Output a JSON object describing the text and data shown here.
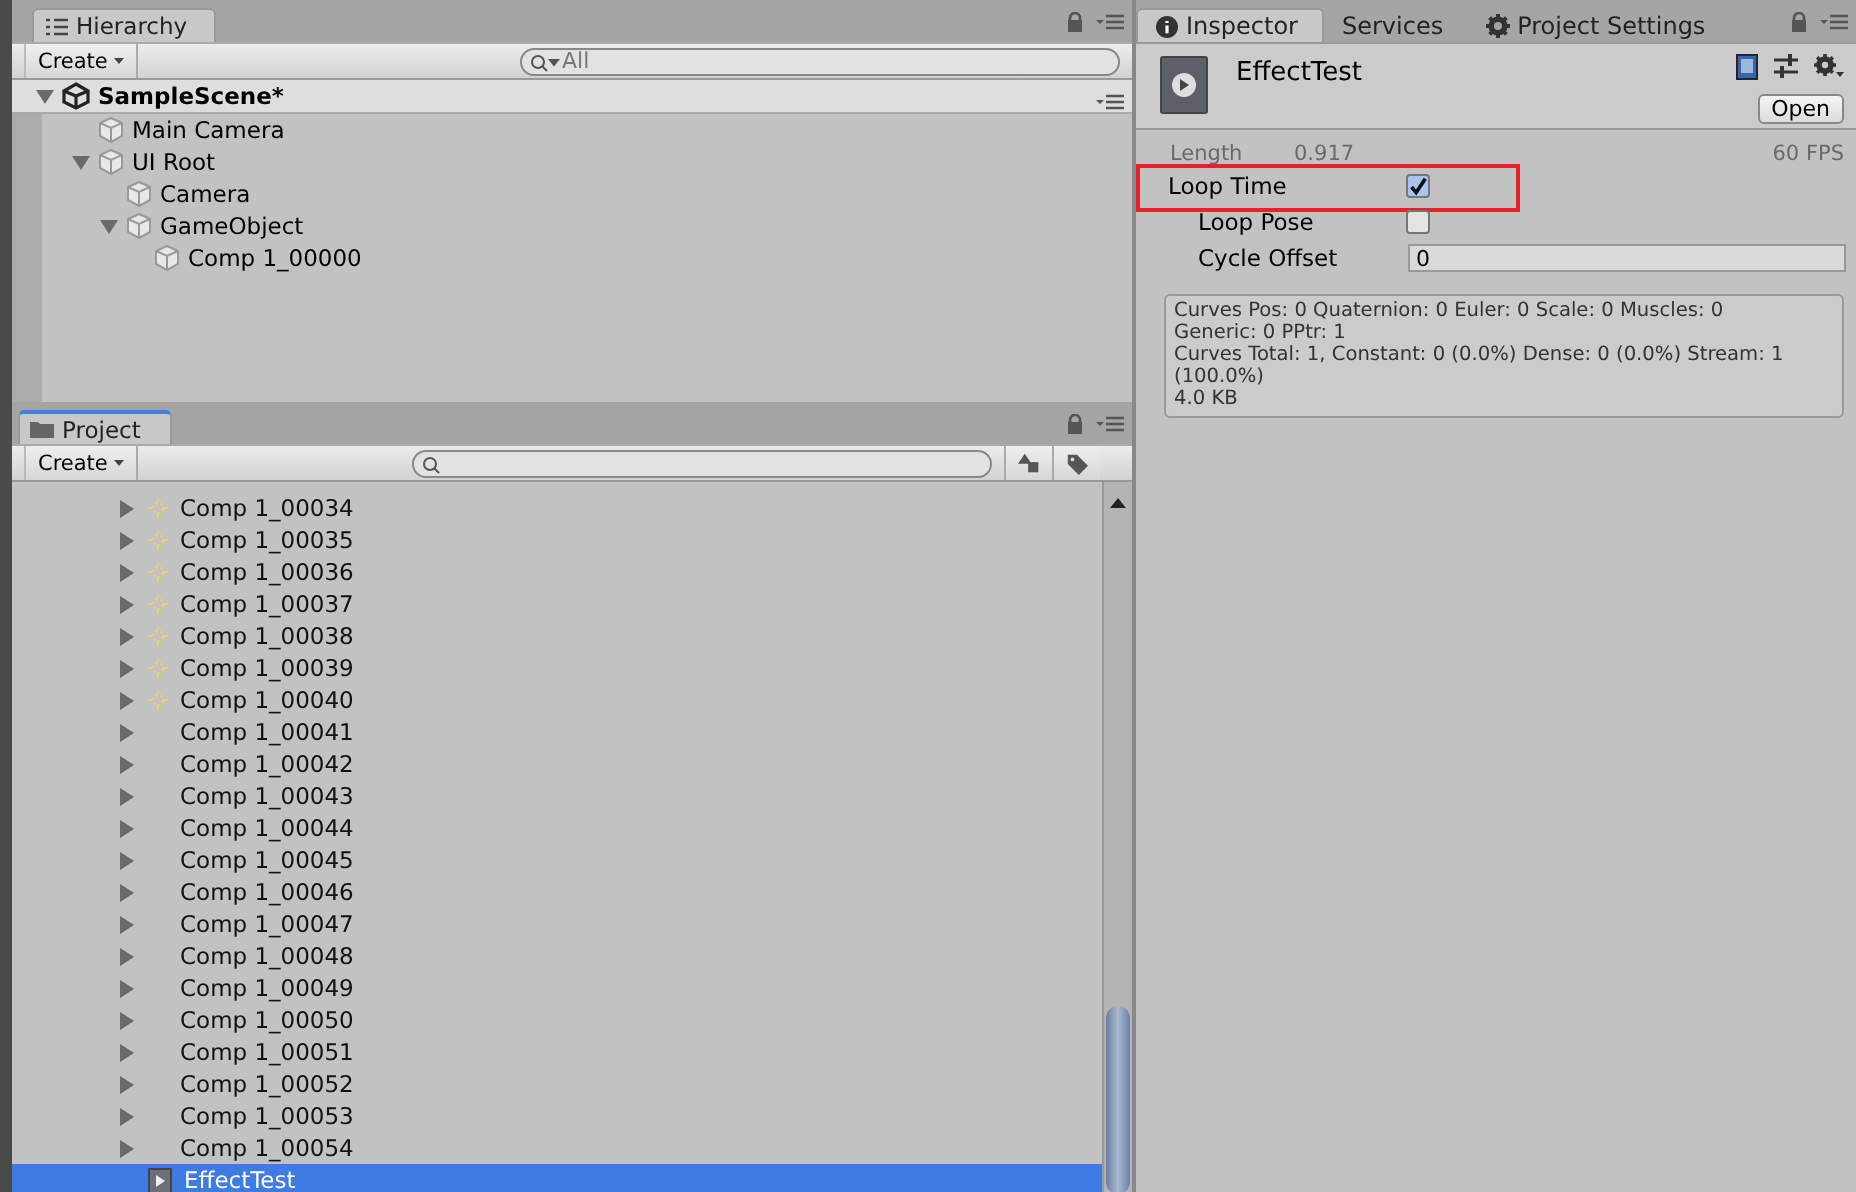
{
  "hierarchy": {
    "tab": "Hierarchy",
    "create": "Create",
    "search": {
      "placeholder": "All"
    },
    "scene": {
      "name": "SampleScene*",
      "expanded": true,
      "children": [
        {
          "label": "Main Camera"
        },
        {
          "label": "UI Root",
          "expanded": true,
          "children": [
            {
              "label": "Camera"
            },
            {
              "label": "GameObject",
              "expanded": true,
              "children": [
                {
                  "label": "Comp 1_00000"
                }
              ]
            }
          ]
        }
      ]
    }
  },
  "project": {
    "tab": "Project",
    "create": "Create",
    "items": [
      {
        "label": "Comp 1_00034",
        "kind": "effect",
        "expanded": false,
        "selected": false
      },
      {
        "label": "Comp 1_00035",
        "kind": "effect",
        "expanded": false,
        "selected": false
      },
      {
        "label": "Comp 1_00036",
        "kind": "effect",
        "expanded": false,
        "selected": false
      },
      {
        "label": "Comp 1_00037",
        "kind": "effect",
        "expanded": false,
        "selected": false
      },
      {
        "label": "Comp 1_00038",
        "kind": "effect",
        "expanded": false,
        "selected": false
      },
      {
        "label": "Comp 1_00039",
        "kind": "effect",
        "expanded": false,
        "selected": false
      },
      {
        "label": "Comp 1_00040",
        "kind": "effect",
        "expanded": false,
        "selected": false
      },
      {
        "label": "Comp 1_00041",
        "kind": "plain",
        "expanded": false,
        "selected": false
      },
      {
        "label": "Comp 1_00042",
        "kind": "plain",
        "expanded": false,
        "selected": false
      },
      {
        "label": "Comp 1_00043",
        "kind": "plain",
        "expanded": false,
        "selected": false
      },
      {
        "label": "Comp 1_00044",
        "kind": "plain",
        "expanded": false,
        "selected": false
      },
      {
        "label": "Comp 1_00045",
        "kind": "plain",
        "expanded": false,
        "selected": false
      },
      {
        "label": "Comp 1_00046",
        "kind": "plain",
        "expanded": false,
        "selected": false
      },
      {
        "label": "Comp 1_00047",
        "kind": "plain",
        "expanded": false,
        "selected": false
      },
      {
        "label": "Comp 1_00048",
        "kind": "plain",
        "expanded": false,
        "selected": false
      },
      {
        "label": "Comp 1_00049",
        "kind": "plain",
        "expanded": false,
        "selected": false
      },
      {
        "label": "Comp 1_00050",
        "kind": "plain",
        "expanded": false,
        "selected": false
      },
      {
        "label": "Comp 1_00051",
        "kind": "plain",
        "expanded": false,
        "selected": false
      },
      {
        "label": "Comp 1_00052",
        "kind": "plain",
        "expanded": false,
        "selected": false
      },
      {
        "label": "Comp 1_00053",
        "kind": "plain",
        "expanded": false,
        "selected": false
      },
      {
        "label": "Comp 1_00054",
        "kind": "plain",
        "expanded": false,
        "selected": false
      },
      {
        "label": "EffectTest",
        "kind": "clip",
        "selected": true
      }
    ]
  },
  "inspector": {
    "tabs": [
      {
        "label": "Inspector",
        "kind": "info",
        "selected": true
      },
      {
        "label": "Services",
        "selected": false
      },
      {
        "label": "Project Settings",
        "kind": "gear",
        "selected": false
      }
    ],
    "asset": {
      "title": "EffectTest",
      "open_button": "Open"
    },
    "length": {
      "label": "Length",
      "value": "0.917"
    },
    "fps": "60 FPS",
    "fields": [
      {
        "kind": "checkbox",
        "label": "Loop Time",
        "checked": true,
        "highlighted": true,
        "children": [
          {
            "kind": "checkbox",
            "label": "Loop Pose",
            "checked": false
          },
          {
            "kind": "number",
            "label": "Cycle Offset",
            "value": "0"
          }
        ]
      }
    ],
    "info": [
      "Curves Pos: 0 Quaternion: 0 Euler: 0 Scale: 0 Muscles: 0",
      "Generic: 0 PPtr: 1",
      "Curves Total: 1, Constant: 0 (0.0%) Dense: 0 (0.0%) Stream: 1",
      "(100.0%)",
      "4.0 KB"
    ]
  }
}
